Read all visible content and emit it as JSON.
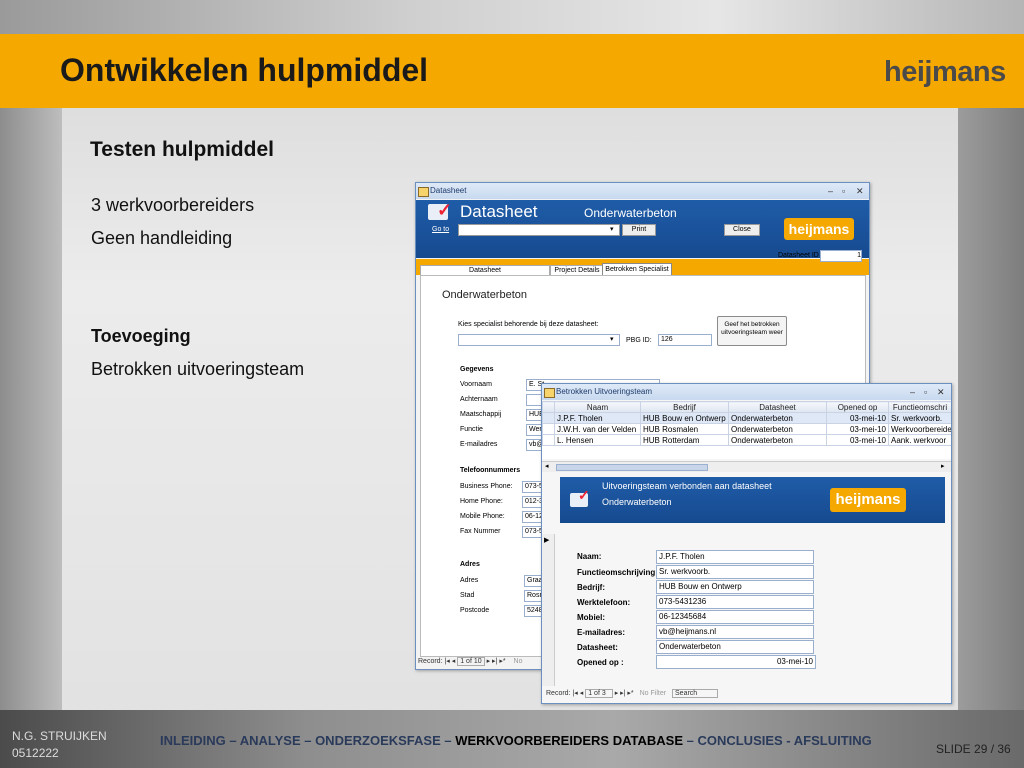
{
  "slide": {
    "title": "Ontwikkelen hulpmiddel",
    "logo": "heijmans",
    "subtitle": "Testen hulpmiddel",
    "lines": [
      "3 werkvoorbereiders",
      "Geen handleiding"
    ],
    "addition_heading": "Toevoeging",
    "addition_text": "Betrokken uitvoeringsteam"
  },
  "footer": {
    "author": "N.G. STRUIJKEN",
    "code": "0512222",
    "nav_before": "INLEIDING – ANALYSE – ONDERZOEKSFASE –",
    "nav_current": "WERKVOORBEREIDERS DATABASE",
    "nav_after": "– CONCLUSIES - AFSLUITING",
    "slide_no": "SLIDE 29 / 36"
  },
  "datasheet_window": {
    "title": "Datasheet",
    "header_title": "Datasheet",
    "header_sub": "Onderwaterbeton",
    "goto_label": "Go to",
    "print_label": "Print",
    "close_label": "Close",
    "logo": "heijmans",
    "id_label": "Datasheet ID",
    "id_value": "1",
    "tabs": [
      "Datasheet",
      "Project Details",
      "Betrokken Specialist"
    ],
    "form_title": "Onderwaterbeton",
    "specialist_prompt": "Kies specialist behorende bij deze datasheet:",
    "pbg_label": "PBG ID:",
    "pbg_value": "126",
    "give_button": "Geef het betrokken uitvoeringsteam weer",
    "group_gegevens": "Gegevens",
    "fields_gegevens": [
      {
        "label": "Voornaam",
        "value": "E. St"
      },
      {
        "label": "Achternaam",
        "value": ""
      },
      {
        "label": "Maatschappij",
        "value": "HUB"
      },
      {
        "label": "Functie",
        "value": "Wer"
      },
      {
        "label": "E-mailadres",
        "value": "vb@"
      }
    ],
    "group_telefoon": "Telefoonnummers",
    "fields_telefoon": [
      {
        "label": "Business Phone:",
        "value": "073-5"
      },
      {
        "label": "Home Phone:",
        "value": "012-3"
      },
      {
        "label": "Mobile Phone:",
        "value": "06-12"
      },
      {
        "label": "Fax Nummer",
        "value": "073-5"
      }
    ],
    "group_adres": "Adres",
    "fields_adres": [
      {
        "label": "Adres",
        "value": "Graa"
      },
      {
        "label": "Stad",
        "value": "Rosn"
      },
      {
        "label": "Postcode",
        "value": "5248"
      }
    ],
    "record_label": "Record:",
    "record_pos": "1 of 10",
    "nofilter": "No"
  },
  "team_window": {
    "title": "Betrokken Uitvoeringsteam",
    "columns": [
      "Naam",
      "Bedrijf",
      "Datasheet",
      "Opened op",
      "Functieomschri"
    ],
    "rows": [
      [
        "J.P.F. Tholen",
        "HUB Bouw en Ontwerp",
        "Onderwaterbeton",
        "03-mei-10",
        "Sr. werkvoorb."
      ],
      [
        "J.W.H. van der Velden",
        "HUB Rosmalen",
        "Onderwaterbeton",
        "03-mei-10",
        "Werkvoorbereider"
      ],
      [
        "L. Hensen",
        "HUB Rotterdam",
        "Onderwaterbeton",
        "03-mei-10",
        "Aank. werkvoor"
      ]
    ],
    "banner_title": "Uitvoeringsteam verbonden aan datasheet",
    "banner_sub": "Onderwaterbeton",
    "logo": "heijmans",
    "detail": [
      {
        "label": "Naam:",
        "value": "J.P.F. Tholen"
      },
      {
        "label": "Functieomschrijving:",
        "value": "Sr. werkvoorb."
      },
      {
        "label": "Bedrijf:",
        "value": "HUB Bouw en Ontwerp"
      },
      {
        "label": "Werktelefoon:",
        "value": "073-5431236"
      },
      {
        "label": "Mobiel:",
        "value": "06-12345684"
      },
      {
        "label": "E-mailadres:",
        "value": "vb@heijmans.nl"
      },
      {
        "label": "Datasheet:",
        "value": "Onderwaterbeton"
      },
      {
        "label": "Opened op :",
        "value": "03-mei-10"
      }
    ],
    "record_label": "Record:",
    "record_pos": "1 of 3",
    "nofilter": "No Filter",
    "search": "Search"
  },
  "colors": {
    "accent": "#f5a800",
    "access_blue": "#1f5ca8"
  }
}
